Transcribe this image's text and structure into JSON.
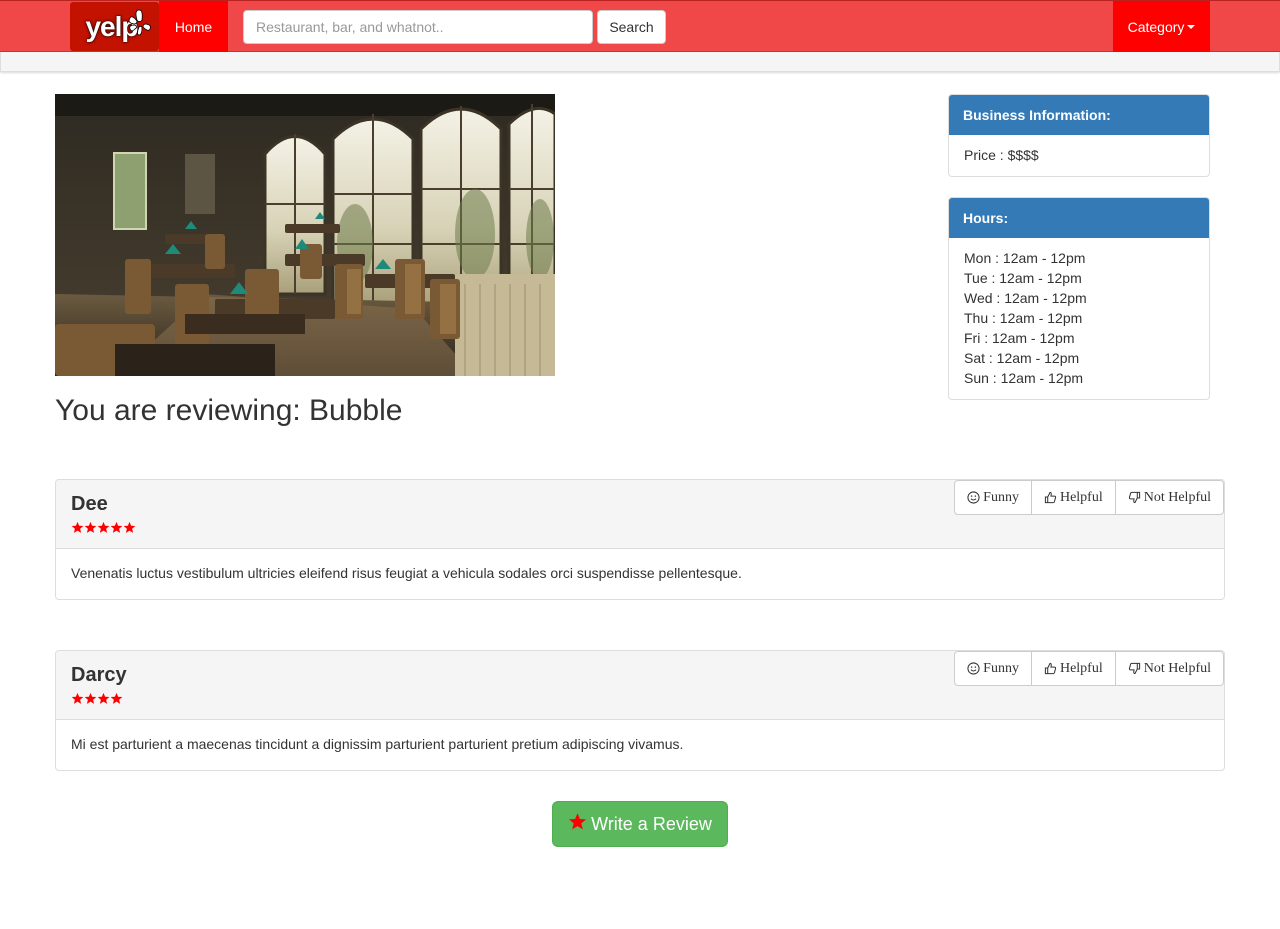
{
  "navbar": {
    "logo_text": "yelp",
    "home_label": "Home",
    "search_placeholder": "Restaurant, bar, and whatnot..",
    "search_button": "Search",
    "category_label": "Category",
    "brand_color": "#f04848",
    "active_color": "#ff0000"
  },
  "page": {
    "title": "You are reviewing: Bubble"
  },
  "business_info": {
    "heading": "Business Information:",
    "price": "Price : $$$$"
  },
  "hours": {
    "heading": "Hours:",
    "lines": [
      "Mon : 12am - 12pm",
      "Tue : 12am - 12pm",
      "Wed : 12am - 12pm",
      "Thu : 12am - 12pm",
      "Fri : 12am - 12pm",
      "Sat : 12am - 12pm",
      "Sun : 12am - 12pm"
    ]
  },
  "reaction_buttons": {
    "funny": "Funny",
    "helpful": "Helpful",
    "not_helpful": "Not Helpful"
  },
  "reviews": [
    {
      "name": "Dee",
      "rating": 5,
      "text": "Venenatis luctus vestibulum ultricies eleifend risus feugiat a vehicula sodales orci suspendisse pellentesque."
    },
    {
      "name": "Darcy",
      "rating": 4,
      "text": "Mi est parturient a maecenas tincidunt a dignissim parturient parturient pretium adipiscing vivamus."
    }
  ],
  "write_review_label": "Write a Review",
  "star_color": "#ff0000",
  "panel_color": "#337ab7",
  "write_button_color": "#5cb85c"
}
